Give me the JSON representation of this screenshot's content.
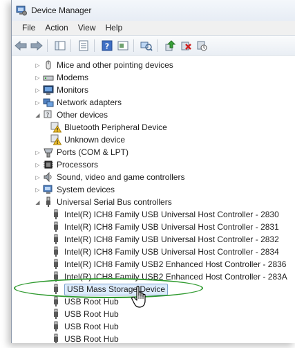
{
  "window": {
    "title": "Device Manager"
  },
  "menu": [
    "File",
    "Action",
    "View",
    "Help"
  ],
  "toolbar": [
    "back-icon",
    "forward-icon",
    "show-hide-icon",
    "properties-icon",
    "help-icon",
    "view-icon",
    "scan-hardware-icon",
    "update-driver-icon",
    "uninstall-icon",
    "disable-icon"
  ],
  "tree": [
    {
      "label": "Mice and other pointing devices",
      "level": 1,
      "icon": "mouse-icon",
      "exp": "▷"
    },
    {
      "label": "Modems",
      "level": 1,
      "icon": "modem-icon",
      "exp": "▷"
    },
    {
      "label": "Monitors",
      "level": 1,
      "icon": "monitor-icon",
      "exp": "▷"
    },
    {
      "label": "Network adapters",
      "level": 1,
      "icon": "network-adapter-icon",
      "exp": "▷"
    },
    {
      "label": "Other devices",
      "level": 1,
      "icon": "other-devices-icon",
      "exp": "◢"
    },
    {
      "label": "Bluetooth Peripheral Device",
      "level": 2,
      "icon": "warning-device-icon"
    },
    {
      "label": "Unknown device",
      "level": 2,
      "icon": "warning-device-icon"
    },
    {
      "label": "Ports (COM & LPT)",
      "level": 1,
      "icon": "port-icon",
      "exp": "▷"
    },
    {
      "label": "Processors",
      "level": 1,
      "icon": "processor-icon",
      "exp": "▷"
    },
    {
      "label": "Sound, video and game controllers",
      "level": 1,
      "icon": "sound-icon",
      "exp": "▷"
    },
    {
      "label": "System devices",
      "level": 1,
      "icon": "system-device-icon",
      "exp": "▷"
    },
    {
      "label": "Universal Serial Bus controllers",
      "level": 1,
      "icon": "usb-icon",
      "exp": "◢"
    },
    {
      "label": "Intel(R) ICH8 Family USB Universal Host Controller - 2830",
      "level": 2,
      "icon": "usb-plug-icon"
    },
    {
      "label": "Intel(R) ICH8 Family USB Universal Host Controller - 2831",
      "level": 2,
      "icon": "usb-plug-icon"
    },
    {
      "label": "Intel(R) ICH8 Family USB Universal Host Controller - 2832",
      "level": 2,
      "icon": "usb-plug-icon"
    },
    {
      "label": "Intel(R) ICH8 Family USB Universal Host Controller - 2834",
      "level": 2,
      "icon": "usb-plug-icon"
    },
    {
      "label": "Intel(R) ICH8 Family USB2 Enhanced Host Controller - 2836",
      "level": 2,
      "icon": "usb-plug-icon"
    },
    {
      "label": "Intel(R) ICH8 Family USB2 Enhanced Host Controller - 283A",
      "level": 2,
      "icon": "usb-plug-icon"
    },
    {
      "label": "USB Mass Storage Device",
      "level": 2,
      "icon": "usb-plug-icon",
      "selected": true
    },
    {
      "label": "USB Root Hub",
      "level": 2,
      "icon": "usb-plug-icon"
    },
    {
      "label": "USB Root Hub",
      "level": 2,
      "icon": "usb-plug-icon"
    },
    {
      "label": "USB Root Hub",
      "level": 2,
      "icon": "usb-plug-icon"
    },
    {
      "label": "USB Root Hub",
      "level": 2,
      "icon": "usb-plug-icon"
    }
  ],
  "colors": {
    "highlight_ellipse": "#2f9a2f",
    "selection_bg": "#dcebfc",
    "selection_border": "#7da2ce"
  }
}
